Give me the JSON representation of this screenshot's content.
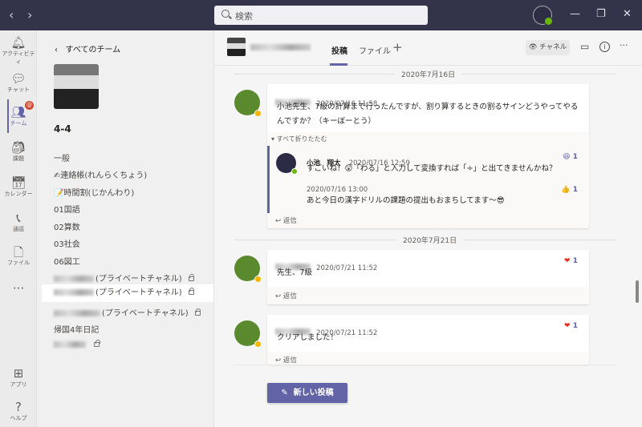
{
  "topbar": {
    "search_placeholder": "検索",
    "back": "‹",
    "forward": "›",
    "minimize": "—",
    "maximize": "❐",
    "close": "✕"
  },
  "rail": [
    {
      "label": "アクティビティ",
      "icon": "bell-icon",
      "glyph": "🔔︎"
    },
    {
      "label": "チャット",
      "icon": "chat-icon",
      "glyph": "💬︎"
    },
    {
      "label": "チーム",
      "icon": "teams-icon",
      "glyph": "👥︎",
      "badge": "@"
    },
    {
      "label": "課題",
      "icon": "backpack-icon",
      "glyph": "🎒︎"
    },
    {
      "label": "カレンダー",
      "icon": "calendar-icon",
      "glyph": "📅︎"
    },
    {
      "label": "通話",
      "icon": "phone-icon",
      "glyph": "📞︎"
    },
    {
      "label": "ファイル",
      "icon": "file-icon",
      "glyph": "🗋"
    },
    {
      "label": "",
      "icon": "more-icon",
      "glyph": "···"
    },
    {
      "label": "アプリ",
      "icon": "apps-icon",
      "glyph": "⊞"
    },
    {
      "label": "ヘルプ",
      "icon": "help-icon",
      "glyph": "?"
    }
  ],
  "panel": {
    "back_label": "すべてのチーム",
    "team_name": "4-4",
    "channels": [
      "一般",
      "✍連絡帳(れんらくちょう)",
      "📝時間割(じかんわり)",
      "01国語",
      "02算数",
      "03社会",
      "06図工",
      "(プライベートチャネル)",
      "(プライベートチャネル)",
      "(プライベートチャネル)",
      "帰国4年日記",
      ""
    ]
  },
  "header": {
    "tabs": [
      "投稿",
      "ファイル"
    ],
    "add_tab": "+",
    "channel_button": "チャネル"
  },
  "feed": {
    "date1": "2020年7月16日",
    "post1": {
      "time": "2020/07/16 11:58",
      "text": "小池先生、7級の計算まで行ったんですが、割り算するときの割るサインどうやってやるんですか？（キーぼーとう）",
      "collapse": "すべて折りたたむ",
      "replies": [
        {
          "author": "小池　翔太",
          "time": "2020/07/16 12:59",
          "text": "すごいね！😲「わる」と入力して変換すれば「÷」と出てきませんかね？",
          "reaction": "😆",
          "count": "1"
        },
        {
          "time": "2020/07/16 13:00",
          "text": "あと今日の漢字ドリルの課題の提出もおまちしてます～😎",
          "reaction": "👍",
          "count": "1"
        }
      ],
      "reply_label": "返信"
    },
    "date2": "2020年7月21日",
    "post2": {
      "time": "2020/07/21 11:52",
      "text": "先生、7級",
      "reaction": "❤",
      "count": "1",
      "reply_label": "返信"
    },
    "post3": {
      "time": "2020/07/21 11:52",
      "text": "クリアしました！",
      "reaction": "❤",
      "count": "1",
      "reply_label": "返信"
    }
  },
  "new_post_label": "新しい投稿",
  "colors": {
    "accent": "#6264a7",
    "titlebar": "#33344a",
    "heart": "#e8302a"
  }
}
